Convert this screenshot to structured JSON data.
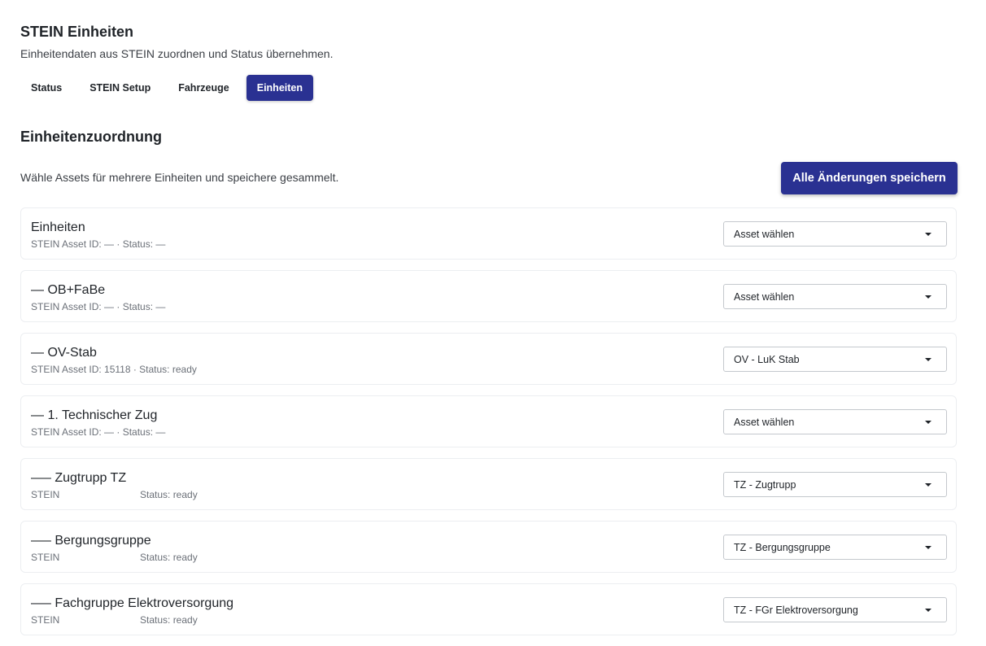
{
  "header": {
    "title": "STEIN Einheiten",
    "subtitle": "Einheitendaten aus STEIN zuordnen und Status übernehmen."
  },
  "tabs": [
    {
      "label": "Status",
      "active": false
    },
    {
      "label": "STEIN Setup",
      "active": false
    },
    {
      "label": "Fahrzeuge",
      "active": false
    },
    {
      "label": "Einheiten",
      "active": true
    }
  ],
  "section": {
    "title": "Einheitenzuordnung",
    "hint": "Wähle Assets für mehrere Einheiten und speichere gesammelt.",
    "save_all_label": "Alle Änderungen speichern"
  },
  "units": [
    {
      "name": "Einheiten",
      "meta": "STEIN Asset ID: — · Status: —",
      "meta_status": "",
      "selected": "Asset wählen"
    },
    {
      "name": "— OB+FaBe",
      "meta": "STEIN Asset ID: — · Status: —",
      "meta_status": "",
      "selected": "Asset wählen"
    },
    {
      "name": "— OV-Stab",
      "meta": "STEIN Asset ID: 15118 · Status: ready",
      "meta_status": "",
      "selected": "OV - LuK Stab"
    },
    {
      "name": "— 1. Technischer Zug",
      "meta": "STEIN Asset ID: — · Status: —",
      "meta_status": "",
      "selected": "Asset wählen"
    },
    {
      "name": "—– Zugtrupp TZ",
      "meta": "STEIN",
      "meta_status": "Status: ready",
      "selected": "TZ - Zugtrupp"
    },
    {
      "name": "—– Bergungsgruppe",
      "meta": "STEIN",
      "meta_status": "Status: ready",
      "selected": "TZ - Bergungsgruppe"
    },
    {
      "name": "—– Fachgruppe Elektroversorgung",
      "meta": "STEIN",
      "meta_status": "Status: ready",
      "selected": "TZ - FGr Elektroversorgung"
    }
  ],
  "colors": {
    "accent": "#2a3192"
  },
  "icons": {
    "dropdown": "chevron-down-icon"
  }
}
